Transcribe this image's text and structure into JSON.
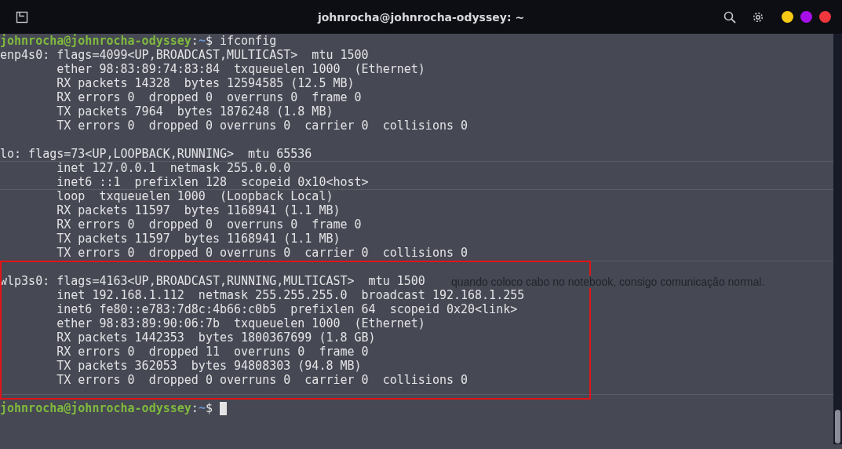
{
  "window": {
    "title": "johnrocha@johnrocha-odyssey: ~"
  },
  "terminal": {
    "lines": [
      {
        "kind": "prompt",
        "user": "johnrocha@johnrocha-odyssey",
        "separator": ":",
        "path": "~",
        "symbol": "$",
        "command": "ifconfig"
      },
      {
        "kind": "output",
        "text": "enp4s0: flags=4099<UP,BROADCAST,MULTICAST>  mtu 1500"
      },
      {
        "kind": "output",
        "text": "        ether 98:83:89:74:83:84  txqueuelen 1000  (Ethernet)"
      },
      {
        "kind": "output",
        "text": "        RX packets 14328  bytes 12594585 (12.5 MB)"
      },
      {
        "kind": "output",
        "text": "        RX errors 0  dropped 0  overruns 0  frame 0"
      },
      {
        "kind": "output",
        "text": "        TX packets 7964  bytes 1876248 (1.8 MB)"
      },
      {
        "kind": "output",
        "text": "        TX errors 0  dropped 0 overruns 0  carrier 0  collisions 0"
      },
      {
        "kind": "blank"
      },
      {
        "kind": "output",
        "text": "lo: flags=73<UP,LOOPBACK,RUNNING>  mtu 65536"
      },
      {
        "kind": "output",
        "text": "        inet 127.0.0.1  netmask 255.0.0.0"
      },
      {
        "kind": "output",
        "text": "        inet6 ::1  prefixlen 128  scopeid 0x10<host>"
      },
      {
        "kind": "output",
        "text": "        loop  txqueuelen 1000  (Loopback Local)"
      },
      {
        "kind": "output",
        "text": "        RX packets 11597  bytes 1168941 (1.1 MB)"
      },
      {
        "kind": "output",
        "text": "        RX errors 0  dropped 0  overruns 0  frame 0"
      },
      {
        "kind": "output",
        "text": "        TX packets 11597  bytes 1168941 (1.1 MB)"
      },
      {
        "kind": "output",
        "text": "        TX errors 0  dropped 0 overruns 0  carrier 0  collisions 0"
      },
      {
        "kind": "blank"
      },
      {
        "kind": "output",
        "text": "wlp3s0: flags=4163<UP,BROADCAST,RUNNING,MULTICAST>  mtu 1500"
      },
      {
        "kind": "output",
        "text": "        inet 192.168.1.112  netmask 255.255.255.0  broadcast 192.168.1.255"
      },
      {
        "kind": "output",
        "text": "        inet6 fe80::e783:7d8c:4b66:c0b5  prefixlen 64  scopeid 0x20<link>"
      },
      {
        "kind": "output",
        "text": "        ether 98:83:89:90:06:7b  txqueuelen 1000  (Ethernet)"
      },
      {
        "kind": "output",
        "text": "        RX packets 1442353  bytes 1800367699 (1.8 GB)"
      },
      {
        "kind": "output",
        "text": "        RX errors 0  dropped 11  overruns 0  frame 0"
      },
      {
        "kind": "output",
        "text": "        TX packets 362053  bytes 94808303 (94.8 MB)"
      },
      {
        "kind": "output",
        "text": "        TX errors 0  dropped 0 overruns 0  carrier 0  collisions 0"
      },
      {
        "kind": "blank"
      },
      {
        "kind": "prompt",
        "user": "johnrocha@johnrocha-odyssey",
        "separator": ":",
        "path": "~",
        "symbol": "$",
        "cursor": true
      }
    ],
    "background_text": "quando coloco cabo no notebook, consigo comunicação normal."
  }
}
